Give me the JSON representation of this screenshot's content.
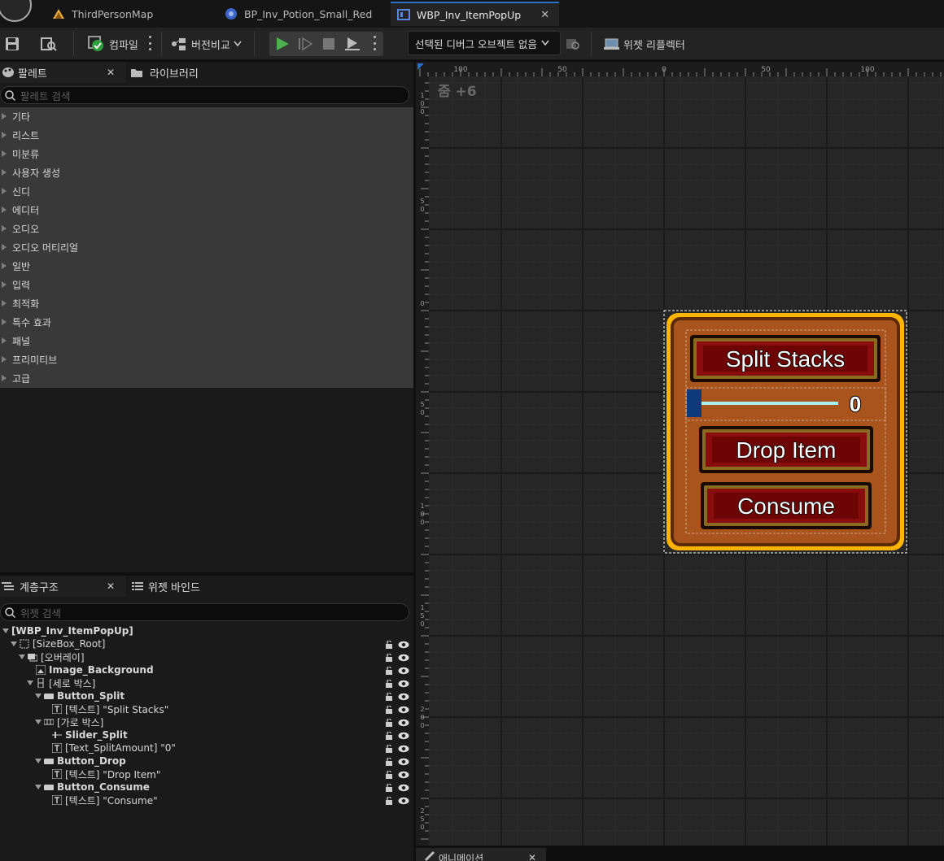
{
  "tabs": [
    {
      "label": "ThirdPersonMap",
      "icon": "level-icon"
    },
    {
      "label": "BP_Inv_Potion_Small_Red",
      "icon": "blueprint-icon"
    },
    {
      "label": "WBP_Inv_ItemPopUp",
      "icon": "widget-blueprint-icon",
      "active": true
    }
  ],
  "toolbar": {
    "compile_label": "컴파일",
    "diff_label": "버전비교",
    "debug_object_label": "선택된 디버그 오브젝트 없음",
    "widget_reflector_label": "위젯 리플렉터"
  },
  "palette": {
    "tab_label": "팔레트",
    "library_tab_label": "라이브러리",
    "search_placeholder": "팔레트 검색",
    "categories": [
      "기타",
      "리스트",
      "미분류",
      "사용자 생성",
      "신디",
      "에디터",
      "오디오",
      "오디오 머티리얼",
      "일반",
      "입력",
      "최적화",
      "특수 효과",
      "패널",
      "프리미티브",
      "고급"
    ]
  },
  "hierarchy": {
    "tab_label": "계층구조",
    "bindings_tab_label": "위젯 바인드",
    "search_placeholder": "위젯 검색",
    "items": [
      {
        "label": "[WBP_Inv_ItemPopUp]",
        "depth": 0,
        "bold": true,
        "icon": "",
        "expand": true,
        "controls": false
      },
      {
        "label": "[SizeBox_Root]",
        "depth": 1,
        "bold": false,
        "icon": "sizebox-icon",
        "expand": true,
        "controls": true
      },
      {
        "label": "[오버레이]",
        "depth": 2,
        "bold": false,
        "icon": "overlay-icon",
        "expand": true,
        "controls": true
      },
      {
        "label": "Image_Background",
        "depth": 3,
        "bold": true,
        "icon": "image-icon",
        "expand": false,
        "controls": true
      },
      {
        "label": "[세로 박스]",
        "depth": 3,
        "bold": false,
        "icon": "vertical-box-icon",
        "expand": true,
        "controls": true
      },
      {
        "label": "Button_Split",
        "depth": 4,
        "bold": true,
        "icon": "button-icon",
        "expand": true,
        "controls": true
      },
      {
        "label": "[텍스트] \"Split Stacks\"",
        "depth": 5,
        "bold": false,
        "icon": "text-icon",
        "expand": false,
        "controls": true
      },
      {
        "label": "[가로 박스]",
        "depth": 4,
        "bold": false,
        "icon": "horizontal-box-icon",
        "expand": true,
        "controls": true
      },
      {
        "label": "Slider_Split",
        "depth": 5,
        "bold": true,
        "icon": "slider-icon",
        "expand": false,
        "controls": true
      },
      {
        "label": "[Text_SplitAmount] \"0\"",
        "depth": 5,
        "bold": false,
        "icon": "text-icon",
        "expand": false,
        "controls": true
      },
      {
        "label": "Button_Drop",
        "depth": 4,
        "bold": true,
        "icon": "button-icon",
        "expand": true,
        "controls": true
      },
      {
        "label": "[텍스트] \"Drop Item\"",
        "depth": 5,
        "bold": false,
        "icon": "text-icon",
        "expand": false,
        "controls": true
      },
      {
        "label": "Button_Consume",
        "depth": 4,
        "bold": true,
        "icon": "button-icon",
        "expand": true,
        "controls": true
      },
      {
        "label": "[텍스트] \"Consume\"",
        "depth": 5,
        "bold": false,
        "icon": "text-icon",
        "expand": false,
        "controls": true
      }
    ]
  },
  "designer": {
    "zoom_label": "줌 +6",
    "ruler_top": [
      "100",
      "50",
      "0",
      "50",
      "100"
    ],
    "ruler_left": [
      "100",
      "50",
      "0",
      "50",
      "100",
      "150",
      "200",
      "250"
    ],
    "popup": {
      "split_button": "Split Stacks",
      "split_amount": "0",
      "slider_value": 0,
      "drop_button": "Drop Item",
      "consume_button": "Consume"
    }
  },
  "bottom_tab": {
    "label": "애니메이션"
  },
  "colors": {
    "accent": "#2a6fc9",
    "play": "#4caf50",
    "popup_border": "#ffc72e",
    "popup_fill": "#a9541c",
    "button_fill": "#8a0d0d"
  }
}
